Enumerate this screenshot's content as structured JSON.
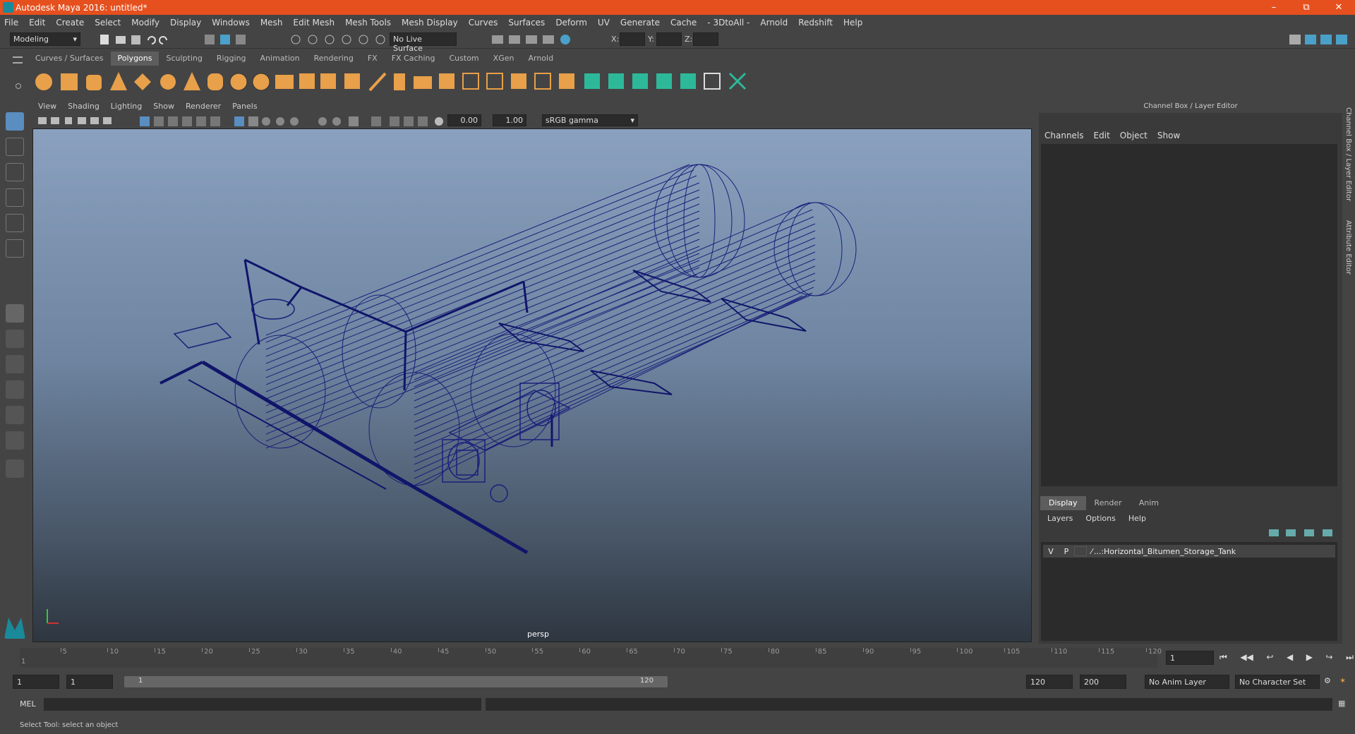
{
  "window": {
    "title": "Autodesk Maya 2016: untitled*"
  },
  "menubar": [
    "File",
    "Edit",
    "Create",
    "Select",
    "Modify",
    "Display",
    "Windows",
    "Mesh",
    "Edit Mesh",
    "Mesh Tools",
    "Mesh Display",
    "Curves",
    "Surfaces",
    "Deform",
    "UV",
    "Generate",
    "Cache",
    "- 3DtoAll -",
    "Arnold",
    "Redshift",
    "Help"
  ],
  "statusline": {
    "mode": "Modeling",
    "live_surface": "No Live Surface",
    "x_label": "X:",
    "y_label": "Y:",
    "z_label": "Z:"
  },
  "shelf_tabs": [
    "Curves / Surfaces",
    "Polygons",
    "Sculpting",
    "Rigging",
    "Animation",
    "Rendering",
    "FX",
    "FX Caching",
    "Custom",
    "XGen",
    "Arnold"
  ],
  "shelf_active": "Polygons",
  "viewport": {
    "menu": [
      "View",
      "Shading",
      "Lighting",
      "Show",
      "Renderer",
      "Panels"
    ],
    "exposure": "0.00",
    "gamma": "1.00",
    "color_space": "sRGB gamma",
    "camera": "persp"
  },
  "channel_box": {
    "title": "Channel Box / Layer Editor",
    "menu": [
      "Channels",
      "Edit",
      "Object",
      "Show"
    ]
  },
  "layer_editor": {
    "tabs": [
      "Display",
      "Render",
      "Anim"
    ],
    "active_tab": "Display",
    "menu": [
      "Layers",
      "Options",
      "Help"
    ],
    "layers": [
      {
        "v": "V",
        "p": "P",
        "name": "...:Horizontal_Bitumen_Storage_Tank"
      }
    ]
  },
  "side_tabs": [
    "Channel Box / Layer Editor",
    "Attribute Editor"
  ],
  "timeline": {
    "ticks": [
      "5",
      "10",
      "15",
      "20",
      "25",
      "30",
      "35",
      "40",
      "45",
      "50",
      "55",
      "60",
      "65",
      "70",
      "75",
      "80",
      "85",
      "90",
      "95",
      "100",
      "105",
      "110",
      "115",
      "120"
    ],
    "start_label": "1",
    "current_frame": "1"
  },
  "range": {
    "start": "1",
    "inner_start": "1",
    "range_start": "1",
    "range_end": "120",
    "end": "120",
    "max_end": "200",
    "anim_layer": "No Anim Layer",
    "character_set": "No Character Set"
  },
  "cmdline": {
    "label": "MEL"
  },
  "helpline": "Select Tool: select an object",
  "colors": {
    "accent": "#e5501e",
    "wire": "#1a1f7a"
  }
}
